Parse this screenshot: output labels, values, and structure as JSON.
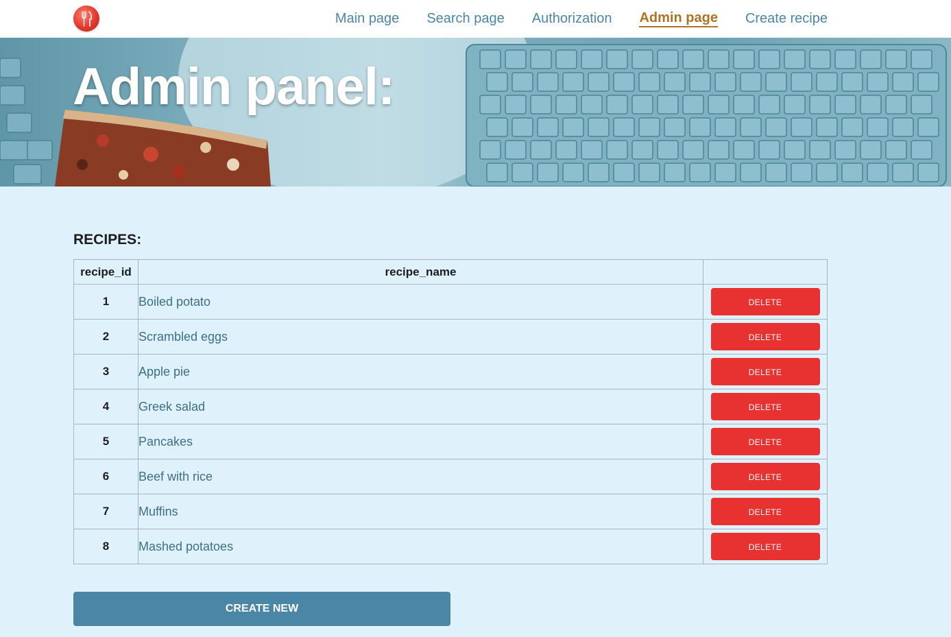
{
  "nav": {
    "items": [
      {
        "label": "Main page",
        "active": false
      },
      {
        "label": "Search page",
        "active": false
      },
      {
        "label": "Authorization",
        "active": false
      },
      {
        "label": "Admin page",
        "active": true
      },
      {
        "label": "Create recipe",
        "active": false
      }
    ]
  },
  "hero": {
    "title": "Admin panel:"
  },
  "recipes": {
    "section_title": "RECIPES:",
    "columns": [
      "recipe_id",
      "recipe_name",
      ""
    ],
    "delete_label": "DELETE",
    "rows": [
      {
        "id": "1",
        "name": "Boiled potato"
      },
      {
        "id": "2",
        "name": "Scrambled eggs"
      },
      {
        "id": "3",
        "name": "Apple pie"
      },
      {
        "id": "4",
        "name": "Greek salad"
      },
      {
        "id": "5",
        "name": "Pancakes"
      },
      {
        "id": "6",
        "name": "Beef with rice"
      },
      {
        "id": "7",
        "name": "Muffins"
      },
      {
        "id": "8",
        "name": "Mashed potatoes"
      }
    ]
  },
  "create_button": {
    "label": "CREATE NEW"
  },
  "colors": {
    "nav_link": "#4a86a6",
    "nav_active": "#b07326",
    "delete": "#e83232",
    "create": "#4a86a6",
    "background": "#dff2fb"
  },
  "icons": {
    "logo": "cutlery-logo-icon"
  }
}
